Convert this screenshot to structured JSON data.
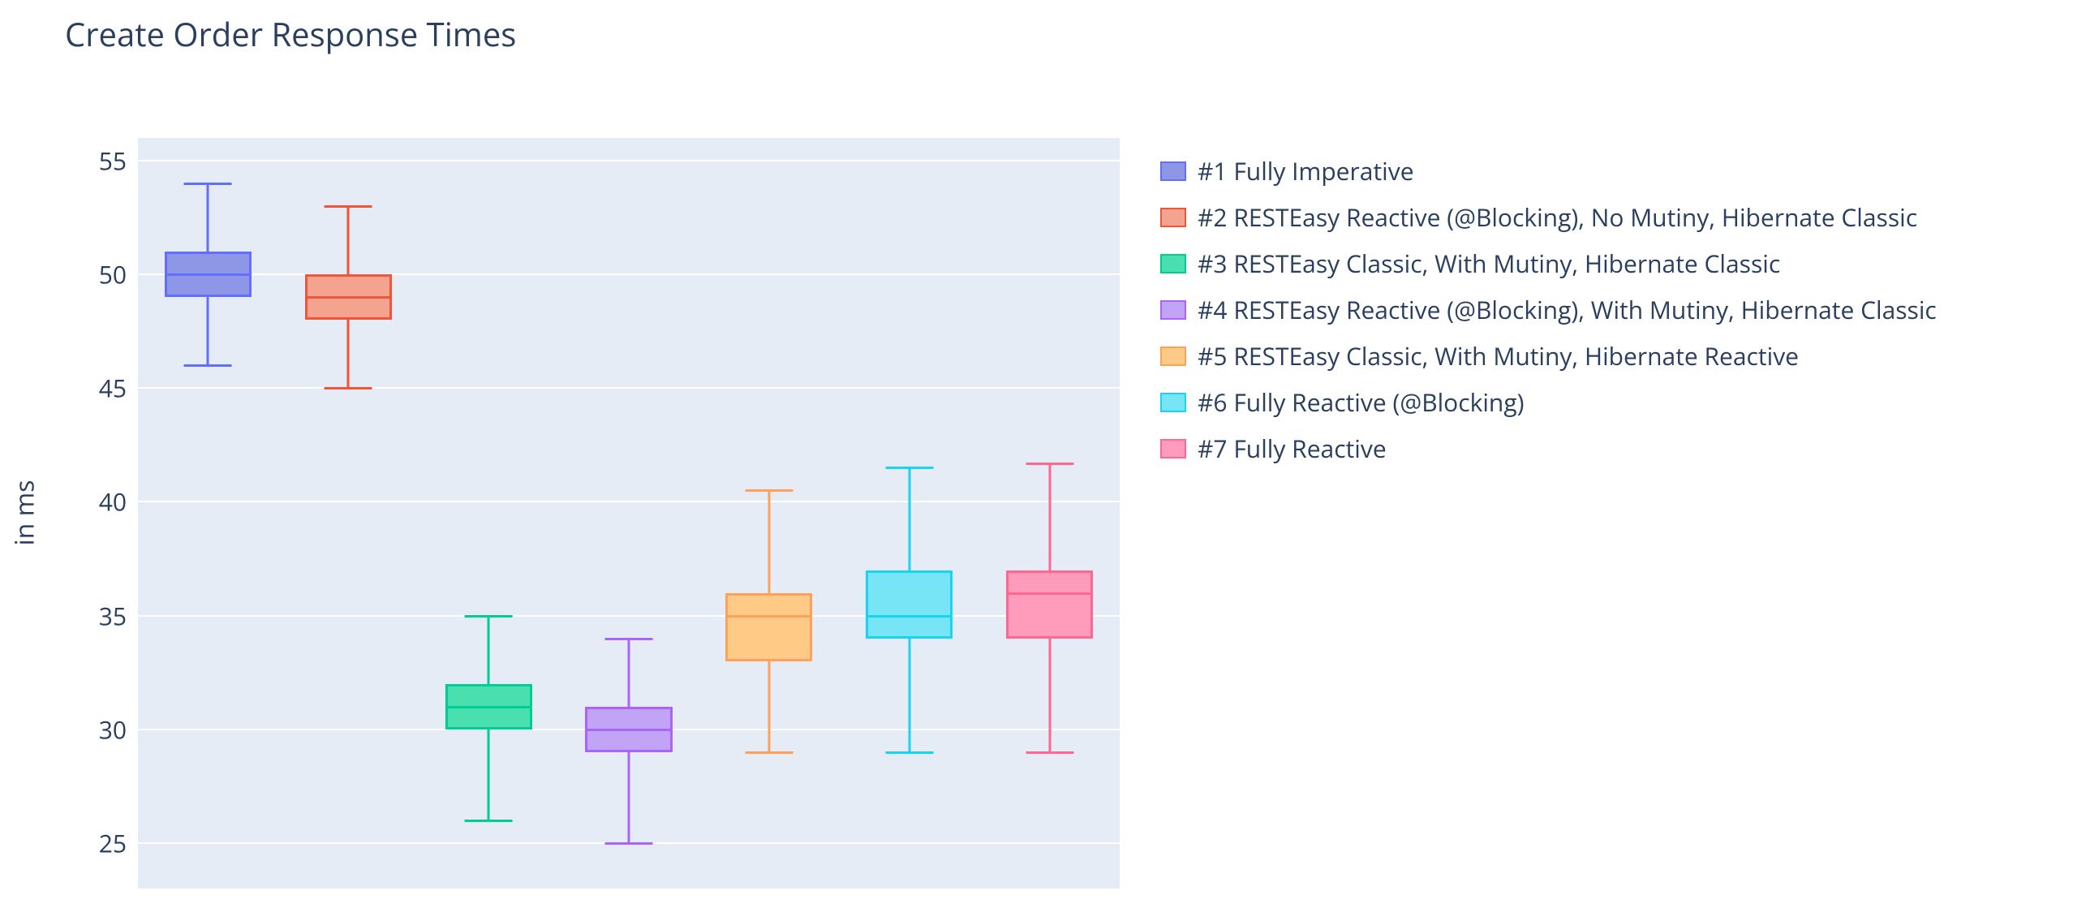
{
  "title": "Create Order Response Times",
  "yaxis_title": "in ms",
  "yticks": [
    25,
    30,
    35,
    40,
    45,
    50,
    55
  ],
  "legend": [
    {
      "label": "#1 Fully Imperative",
      "fill": "#8e96e6",
      "line": "#636efa"
    },
    {
      "label": "#2 RESTEasy Reactive (@Blocking), No Mutiny, Hibernate Classic",
      "fill": "#f3a38e",
      "line": "#ef553b"
    },
    {
      "label": "#3 RESTEasy Classic, With Mutiny, Hibernate Classic",
      "fill": "#4adfaf",
      "line": "#00cc96"
    },
    {
      "label": "#4 RESTEasy Reactive (@Blocking), With Mutiny, Hibernate Classic",
      "fill": "#c1a4f5",
      "line": "#ab63fa"
    },
    {
      "label": "#5 RESTEasy Classic, With Mutiny, Hibernate Reactive",
      "fill": "#ffca85",
      "line": "#ffa15a"
    },
    {
      "label": "#6 Fully Reactive (@Blocking)",
      "fill": "#77e5f6",
      "line": "#19d3f3"
    },
    {
      "label": "#7 Fully Reactive",
      "fill": "#ff9cbb",
      "line": "#ff6692"
    }
  ],
  "chart_data": {
    "type": "box",
    "ylabel": "in ms",
    "ylim": [
      23,
      56
    ],
    "title": "Create Order Response Times",
    "series": [
      {
        "name": "#1 Fully Imperative",
        "min": 46,
        "q1": 49,
        "median": 50,
        "q3": 51,
        "max": 54,
        "fill": "#8e96e6",
        "line": "#636efa"
      },
      {
        "name": "#2 RESTEasy Reactive (@Blocking), No Mutiny, Hibernate Classic",
        "min": 45,
        "q1": 48,
        "median": 49,
        "q3": 50,
        "max": 53,
        "fill": "#f3a38e",
        "line": "#ef553b"
      },
      {
        "name": "#3 RESTEasy Classic, With Mutiny, Hibernate Classic",
        "min": 26,
        "q1": 30,
        "median": 31,
        "q3": 32,
        "max": 35,
        "fill": "#4adfaf",
        "line": "#00cc96"
      },
      {
        "name": "#4 RESTEasy Reactive (@Blocking), With Mutiny, Hibernate Classic",
        "min": 25,
        "q1": 29,
        "median": 30,
        "q3": 31,
        "max": 34,
        "fill": "#c1a4f5",
        "line": "#ab63fa"
      },
      {
        "name": "#5 RESTEasy Classic, With Mutiny, Hibernate Reactive",
        "min": 29,
        "q1": 33,
        "median": 35,
        "q3": 36,
        "max": 40.5,
        "fill": "#ffca85",
        "line": "#ffa15a"
      },
      {
        "name": "#6 Fully Reactive (@Blocking)",
        "min": 29,
        "q1": 34,
        "median": 35,
        "q3": 37,
        "max": 41.5,
        "fill": "#77e5f6",
        "line": "#19d3f3"
      },
      {
        "name": "#7 Fully Reactive",
        "min": 29,
        "q1": 34,
        "median": 36,
        "q3": 37,
        "max": 41.7,
        "fill": "#ff9cbb",
        "line": "#ff6692"
      }
    ]
  }
}
